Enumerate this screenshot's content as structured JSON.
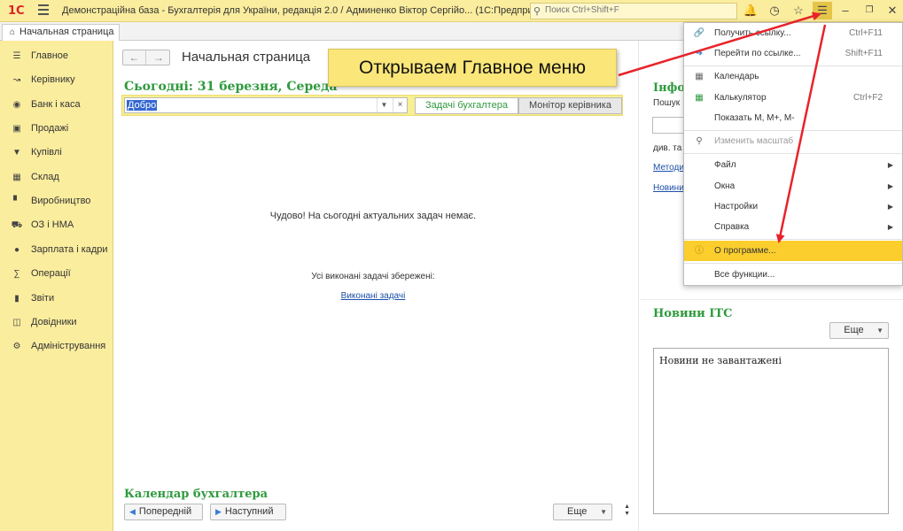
{
  "titlebar": {
    "logo": "1С",
    "title": "Демонстраційна база - Бухгалтерія для України, редакція 2.0 / Админенко Віктор Сергійо...  (1С:Предприятие)",
    "search_placeholder": "Поиск Ctrl+Shift+F",
    "icons": [
      "bell-icon",
      "history-icon",
      "star-icon",
      "main-menu-icon",
      "minimize-icon",
      "restore-icon",
      "close-icon"
    ]
  },
  "tabs": {
    "home": "Начальная страница"
  },
  "sidebar": {
    "items": [
      {
        "label": "Главное",
        "icon": "list-icon"
      },
      {
        "label": "Керівнику",
        "icon": "trend-icon"
      },
      {
        "label": "Банк і каса",
        "icon": "coin-icon"
      },
      {
        "label": "Продажі",
        "icon": "bag-icon"
      },
      {
        "label": "Купівлі",
        "icon": "cart-icon"
      },
      {
        "label": "Склад",
        "icon": "warehouse-icon"
      },
      {
        "label": "Виробництво",
        "icon": "factory-icon"
      },
      {
        "label": "ОЗ і НМА",
        "icon": "truck-icon"
      },
      {
        "label": "Зарплата і кадри",
        "icon": "person-icon"
      },
      {
        "label": "Операції",
        "icon": "operations-icon"
      },
      {
        "label": "Звіти",
        "icon": "bar-chart-icon"
      },
      {
        "label": "Довідники",
        "icon": "books-icon"
      },
      {
        "label": "Адміністрування",
        "icon": "gear-icon"
      }
    ]
  },
  "main": {
    "title": "Начальная страница",
    "today": "Сьогодні: 31 березня, Середа",
    "filter_value": "Добро",
    "tab_tasks": "Задачі бухгалтера",
    "tab_monitor": "Монітор керівника",
    "no_tasks": "Чудово! На сьогодні актуальних задач немає.",
    "saved_tasks": "Усі виконані задачі збережені:",
    "done_link": "Виконані задачі",
    "calendar_title": "Календар бухгалтера",
    "prev_button": "Попередній",
    "next_button": "Наступний",
    "more_button": "Еще"
  },
  "right": {
    "info_title": "Інфо",
    "search_label": "Пошук",
    "text_line": "див. та",
    "link1": "Методи",
    "link2": "Новини",
    "news_title": "Новини ІТС",
    "news_more": "Еще",
    "news_empty": "Новини не завантажені"
  },
  "menu": {
    "items": [
      {
        "label": "Получить ссылку...",
        "shortcut": "Ctrl+F11",
        "icon": "link-icon",
        "disabled": false
      },
      {
        "label": "Перейти по ссылке...",
        "shortcut": "Shift+F11",
        "icon": "go-link-icon",
        "disabled": false
      },
      {
        "label": "Календарь",
        "shortcut": "",
        "icon": "calendar-icon",
        "disabled": false
      },
      {
        "label": "Калькулятор",
        "shortcut": "Ctrl+F2",
        "icon": "calculator-icon",
        "disabled": false
      },
      {
        "label": "Показать М, М+, М-",
        "shortcut": "",
        "icon": "",
        "disabled": false
      },
      {
        "label": "Изменить масштаб",
        "shortcut": "",
        "icon": "zoom-icon",
        "disabled": true
      },
      {
        "label": "Файл",
        "shortcut": "",
        "icon": "",
        "submenu": true
      },
      {
        "label": "Окна",
        "shortcut": "",
        "icon": "",
        "submenu": true
      },
      {
        "label": "Настройки",
        "shortcut": "",
        "icon": "",
        "submenu": true
      },
      {
        "label": "Справка",
        "shortcut": "",
        "icon": "",
        "submenu": true
      },
      {
        "label": "О программе...",
        "shortcut": "",
        "icon": "info-icon",
        "highlighted": true
      },
      {
        "label": "Все функции...",
        "shortcut": "",
        "icon": ""
      }
    ]
  },
  "callout": {
    "text": "Открываем Главное меню"
  },
  "colors": {
    "yellow": "#fbed9e",
    "green": "#2e9a3d",
    "highlight": "#fbce2e",
    "arrow": "#e8232a",
    "link": "#1d4fa8"
  }
}
